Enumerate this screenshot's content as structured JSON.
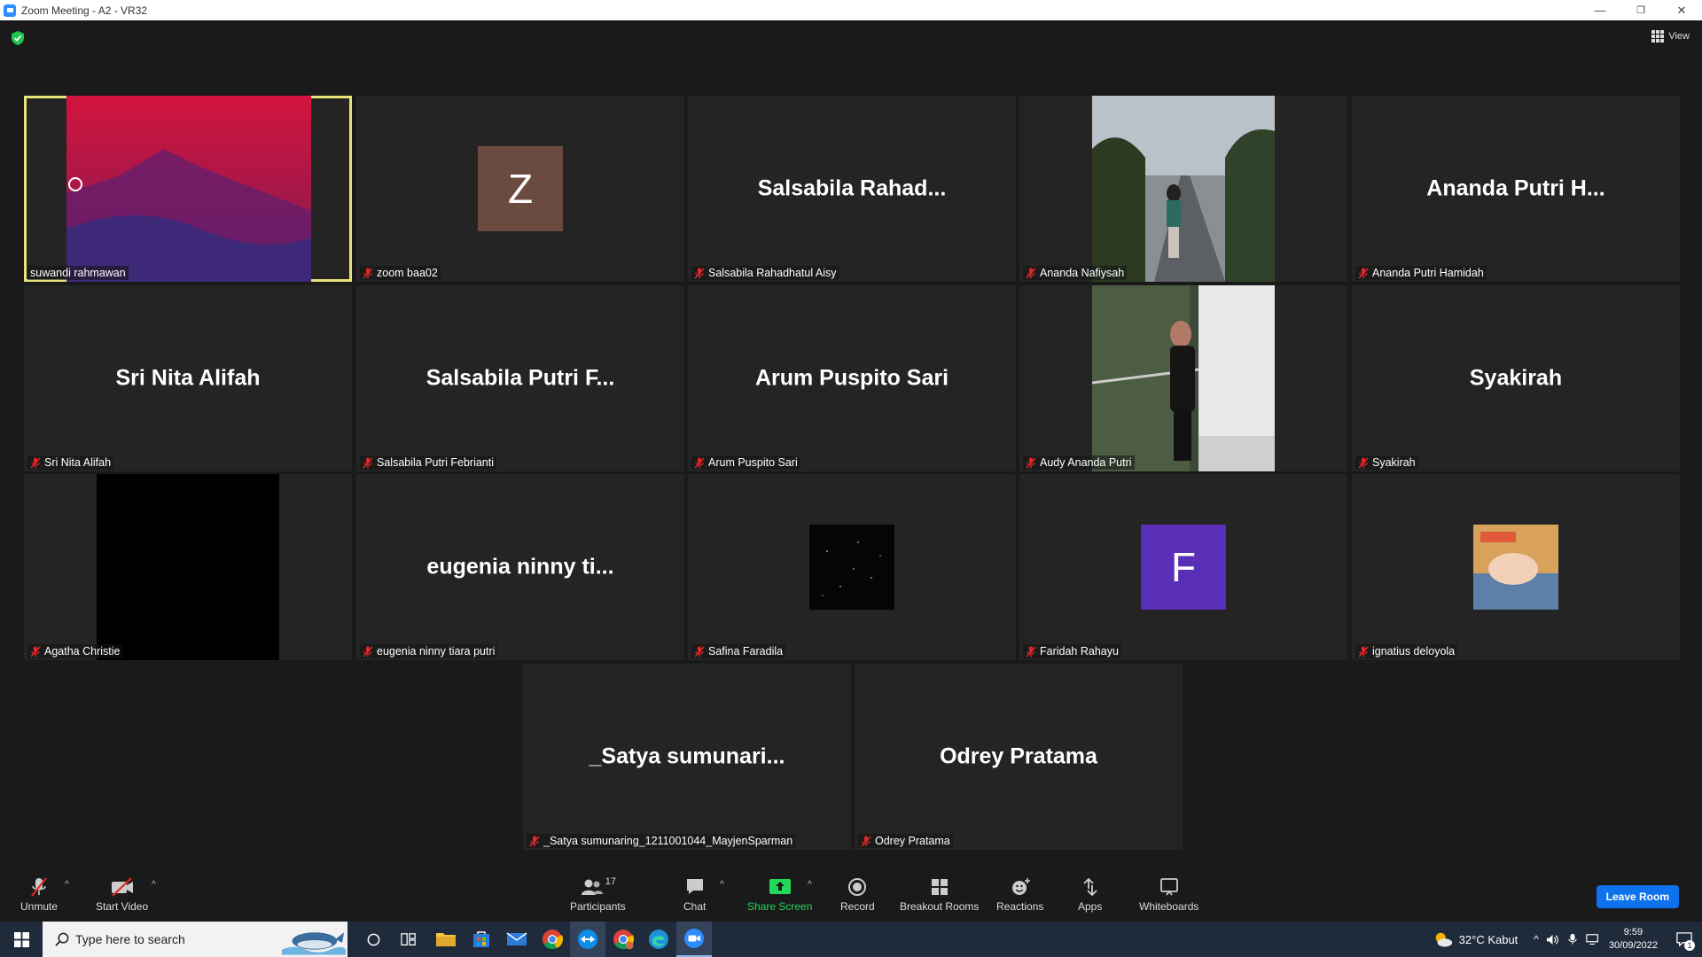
{
  "window": {
    "title": "Zoom Meeting - A2 - VR32",
    "minimize": "—",
    "restore": "❐",
    "close": "✕"
  },
  "header": {
    "view_label": "View",
    "shield_icon": "security-shield-icon"
  },
  "tiles": [
    {
      "name": "suwandi rahmawan",
      "display": "",
      "type": "video-mountain",
      "muted": false,
      "active": true
    },
    {
      "name": "zoom baa02",
      "display": "",
      "type": "avatar",
      "avatar_letter": "Z",
      "avatar_color": "#6b4a3f",
      "muted": true
    },
    {
      "name": "Salsabila Rahadhatul Aisy",
      "display": "Salsabila  Rahad...",
      "type": "name",
      "muted": true
    },
    {
      "name": "Ananda Nafiysah",
      "display": "",
      "type": "video-street",
      "muted": true
    },
    {
      "name": "Ananda Putri Hamidah",
      "display": "Ananda Putri H...",
      "type": "name",
      "muted": true
    },
    {
      "name": "Sri Nita Alifah",
      "display": "Sri Nita Alifah",
      "type": "name",
      "muted": true
    },
    {
      "name": "Salsabila Putri Febrianti",
      "display": "Salsabila Putri F...",
      "type": "name",
      "muted": true
    },
    {
      "name": "Arum Puspito Sari",
      "display": "Arum Puspito Sari",
      "type": "name",
      "muted": true
    },
    {
      "name": "Audy Ananda Putri",
      "display": "",
      "type": "video-window",
      "muted": true
    },
    {
      "name": "Syakirah",
      "display": "Syakirah",
      "type": "name",
      "muted": true
    },
    {
      "name": "Agatha Christie",
      "display": "",
      "type": "video-black",
      "muted": true
    },
    {
      "name": "eugenia ninny tiara putri",
      "display": "eugenia ninny ti...",
      "type": "name",
      "muted": true
    },
    {
      "name": "Safina Faradila",
      "display": "",
      "type": "avatar-stars",
      "muted": true
    },
    {
      "name": "Faridah Rahayu",
      "display": "",
      "type": "avatar",
      "avatar_letter": "F",
      "avatar_color": "#5a2fb8",
      "muted": true
    },
    {
      "name": "ignatius deloyola",
      "display": "",
      "type": "avatar-photo",
      "muted": true
    },
    {
      "name": "_Satya sumunaring_1211001044_MayjenSparman",
      "display": "_Satya  sumunari...",
      "type": "name",
      "muted": true
    },
    {
      "name": "Odrey Pratama",
      "display": "Odrey Pratama",
      "type": "name",
      "muted": true
    }
  ],
  "toolbar": {
    "unmute": "Unmute",
    "start_video": "Start Video",
    "participants": "Participants",
    "participants_count": "17",
    "chat": "Chat",
    "share_screen": "Share Screen",
    "record": "Record",
    "breakout_rooms": "Breakout Rooms",
    "reactions": "Reactions",
    "apps": "Apps",
    "whiteboards": "Whiteboards",
    "leave": "Leave Room",
    "caret": "^"
  },
  "taskbar": {
    "search_placeholder": "Type here to search",
    "weather": "32°C  Kabut",
    "time": "9:59",
    "date": "30/09/2022",
    "notification_count": "1",
    "apps": [
      "task-view-icon",
      "file-explorer-icon",
      "store-icon",
      "mail-icon",
      "chrome-icon",
      "teamviewer-icon",
      "chrome-profile-icon",
      "edge-icon",
      "zoom-icon"
    ]
  },
  "colors": {
    "active_speaker": "#e8e27a",
    "mute_red": "#e02828",
    "share_green": "#23d959",
    "leave_blue": "#0e72ed"
  }
}
